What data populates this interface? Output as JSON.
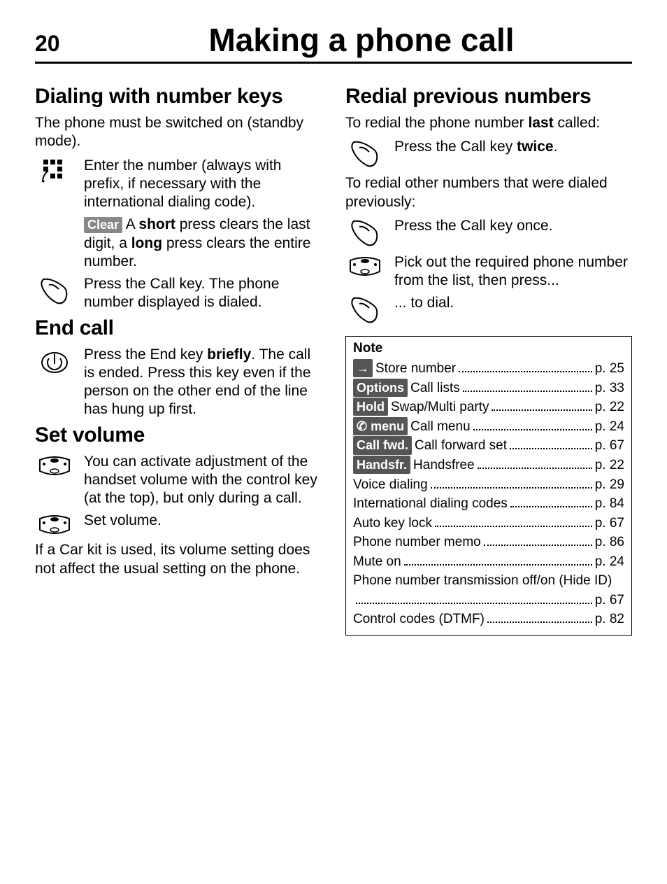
{
  "page_number": "20",
  "page_title": "Making a phone call",
  "left": {
    "h1": "Dialing with number keys",
    "intro": "The phone must be switched on (standby mode).",
    "r1": "Enter the number (always with prefix, if necessary with the international dialing code).",
    "r2_badge": "Clear",
    "r2_a": " A ",
    "r2_b": "short",
    "r2_c": " press clears the last digit, a ",
    "r2_d": "long",
    "r2_e": " press clears the entire number.",
    "r3": "Press the Call key. The phone number displayed is dialed.",
    "h2": "End call",
    "end_a": "Press the End key ",
    "end_b": "briefly",
    "end_c": ". The call is ended. Press this key even if the person on the other end of the line has hung up first.",
    "h3": "Set volume",
    "vol1": "You can activate adjustment of the handset volume with the control key (at the top), but only during a call.",
    "vol2": "Set volume.",
    "vol3": "If a Car kit is used, its volume setting does not affect the usual setting on the phone."
  },
  "right": {
    "h1": "Redial previous numbers",
    "intro_a": "To redial the phone number ",
    "intro_b": "last",
    "intro_c": " called:",
    "r1_a": "Press the Call key ",
    "r1_b": "twice",
    "r1_c": ".",
    "mid": "To redial other numbers that were dialed previously:",
    "r2": "Press the Call key once.",
    "r3": "Pick out the required phone number from the list, then press...",
    "r4": "... to dial.",
    "note_title": "Note",
    "notes": [
      {
        "badge": "→",
        "label": "Store number",
        "page": "p. 25"
      },
      {
        "badge": "Options",
        "label": "Call lists",
        "page": "p. 33"
      },
      {
        "badge": "Hold",
        "label": "Swap/Multi party",
        "page": "p. 22"
      },
      {
        "badge": "✆ menu",
        "label": "Call menu",
        "page": "p. 24"
      },
      {
        "badge": "Call fwd.",
        "label": "Call forward set",
        "page": "p. 67"
      },
      {
        "badge": "Handsfr.",
        "label": "Handsfree",
        "page": "p. 22"
      },
      {
        "badge": "",
        "label": "Voice dialing",
        "page": "p. 29"
      },
      {
        "badge": "",
        "label": "International dialing codes",
        "page": "p. 84"
      },
      {
        "badge": "",
        "label": "Auto key lock",
        "page": "p. 67"
      },
      {
        "badge": "",
        "label": "Phone number memo",
        "page": "p. 86"
      },
      {
        "badge": "",
        "label": "Mute on",
        "page": "p. 24"
      },
      {
        "badge": "",
        "label": "Phone number transmission off/on (Hide ID)",
        "page": "p. 67",
        "wrap": true
      },
      {
        "badge": "",
        "label": "Control codes (DTMF)",
        "page": "p. 82"
      }
    ]
  }
}
